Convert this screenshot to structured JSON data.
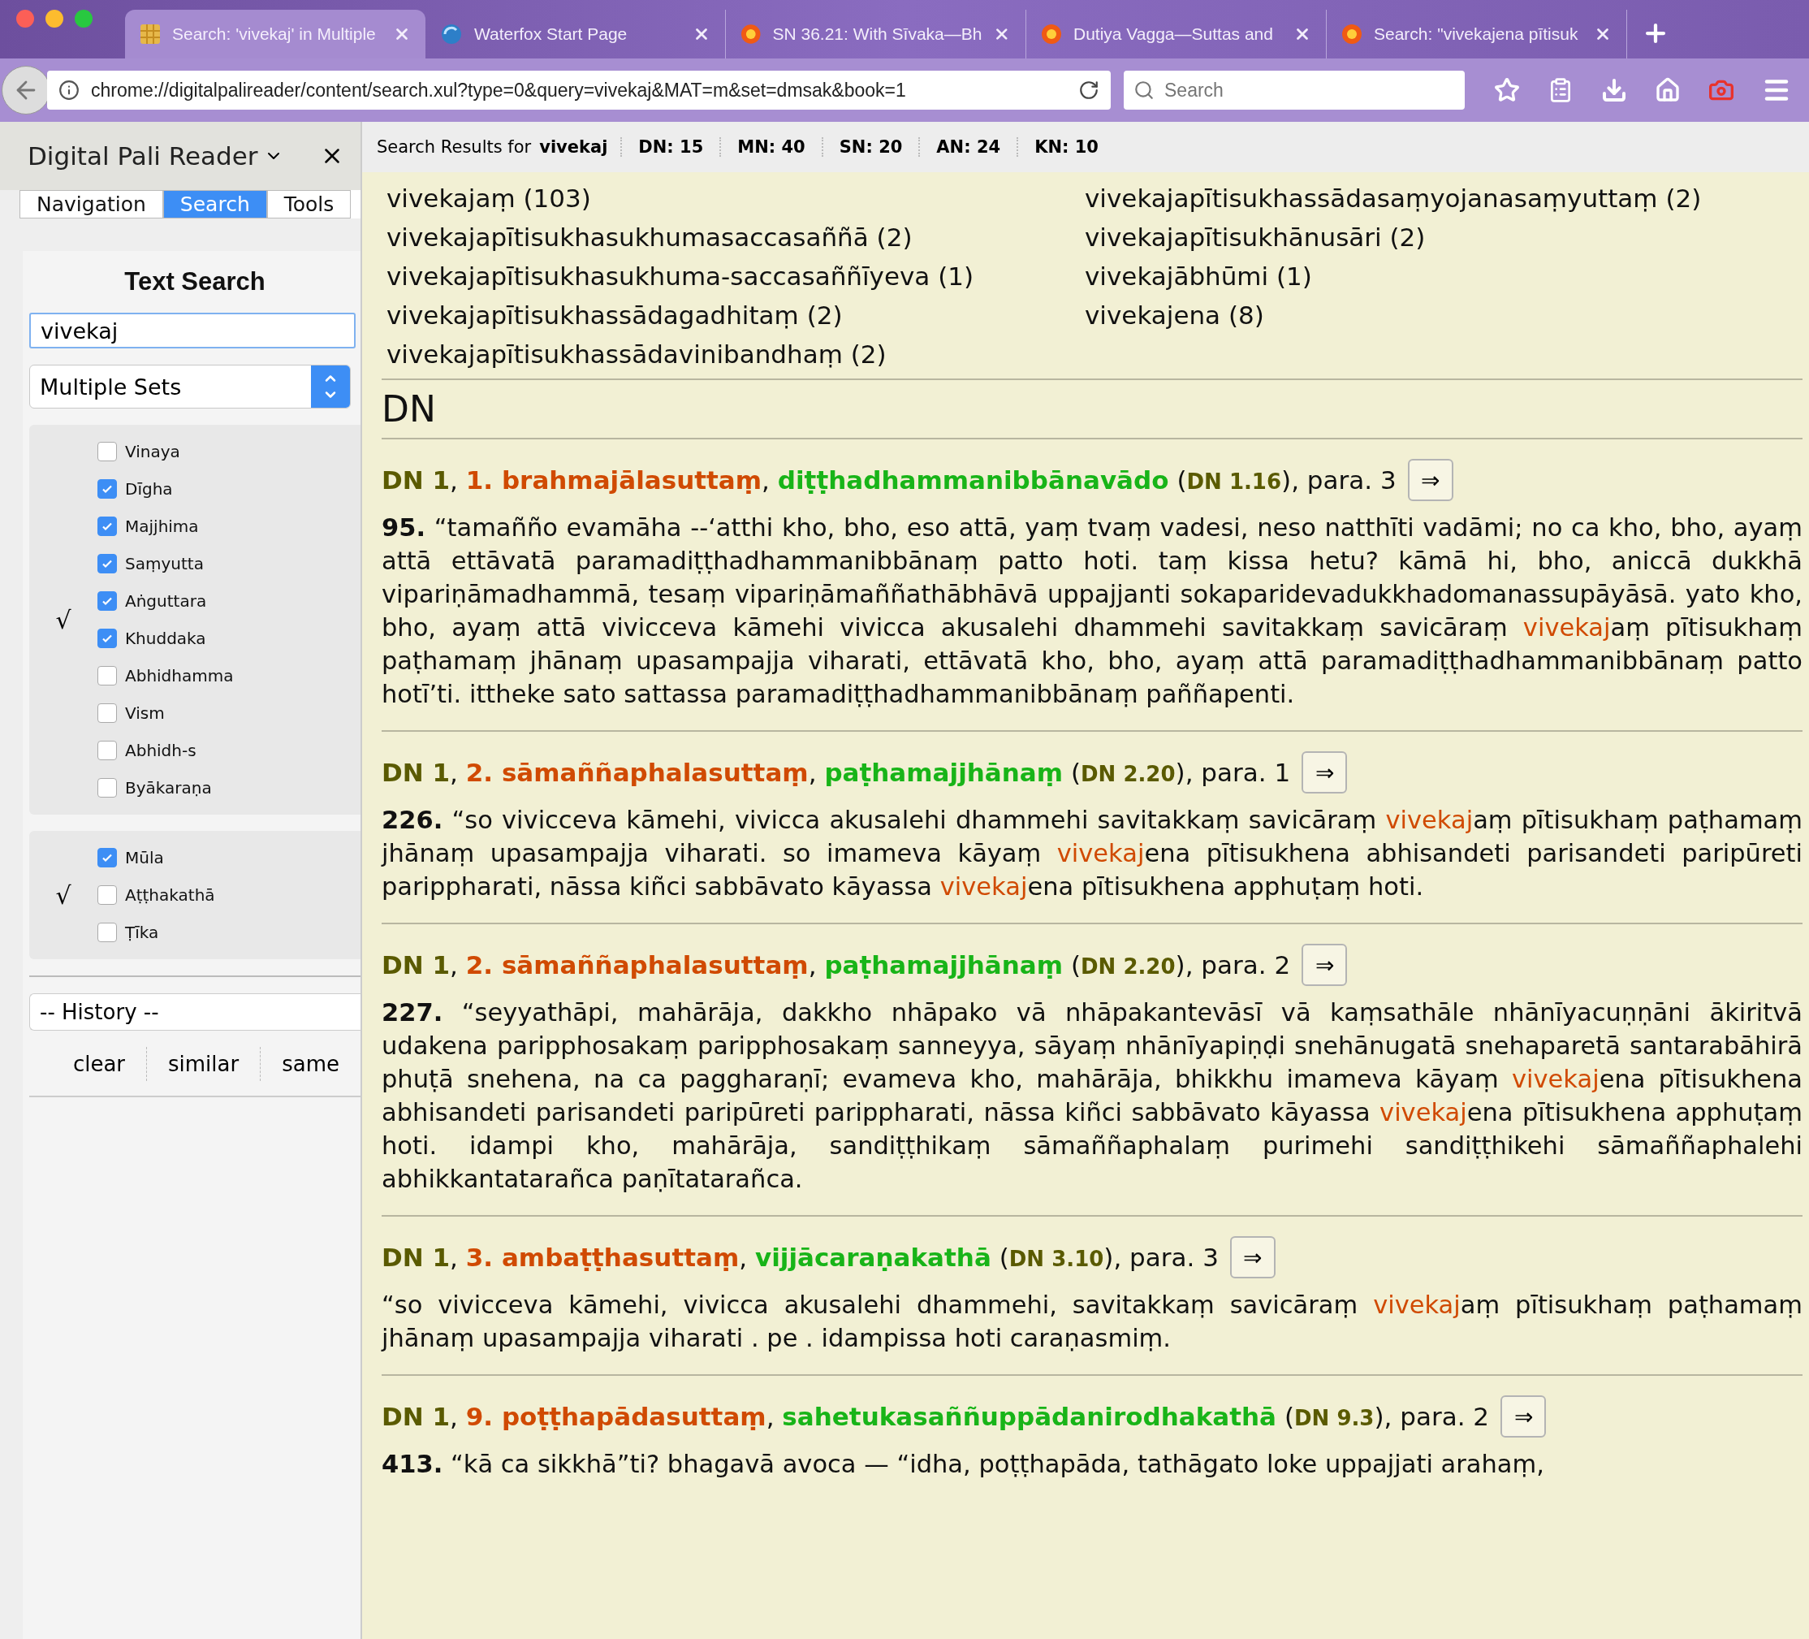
{
  "browser": {
    "tabs": [
      {
        "title": "Search: 'vivekaj' in Multiple",
        "kind": "tile",
        "selected": true
      },
      {
        "title": "Waterfox Start Page",
        "kind": "globe",
        "selected": false
      },
      {
        "title": "SN 36.21: With Sīvaka—Bh",
        "kind": "sun",
        "selected": false
      },
      {
        "title": "Dutiya Vagga—Suttas and",
        "kind": "sun",
        "selected": false
      },
      {
        "title": "Search: \"vivekajena pītisuk",
        "kind": "sun",
        "selected": false
      }
    ],
    "url": "chrome://digitalpalireader/content/search.xul?type=0&query=vivekaj&MAT=m&set=dmsak&book=1",
    "search": {
      "placeholder": "Search"
    }
  },
  "sidebar": {
    "title": "Digital Pali Reader",
    "tabs": [
      {
        "label": "Navigation",
        "selected": false
      },
      {
        "label": "Search",
        "selected": true
      },
      {
        "label": "Tools",
        "selected": false
      }
    ],
    "heading": "Text Search",
    "query": "vivekaj",
    "set": "Multiple Sets",
    "groups": [
      {
        "mark": "√",
        "items": [
          {
            "label": "Vinaya",
            "checked": false
          },
          {
            "label": "Dīgha",
            "checked": true
          },
          {
            "label": "Majjhima",
            "checked": true
          },
          {
            "label": "Saṃyutta",
            "checked": true
          },
          {
            "label": "Aṅguttara",
            "checked": true
          },
          {
            "label": "Khuddaka",
            "checked": true
          },
          {
            "label": "Abhidhamma",
            "checked": false
          },
          {
            "label": "Vism",
            "checked": false
          },
          {
            "label": "Abhidh-s",
            "checked": false
          },
          {
            "label": "Byākaraṇa",
            "checked": false
          }
        ]
      },
      {
        "mark": "√",
        "items": [
          {
            "label": "Mūla",
            "checked": true
          },
          {
            "label": "Aṭṭhakathā",
            "checked": false
          },
          {
            "label": "Ṭīka",
            "checked": false
          }
        ]
      }
    ],
    "history": "-- History --",
    "actions": [
      "clear",
      "similar",
      "same"
    ]
  },
  "results": {
    "label": "Search Results for",
    "query": "vivekaj",
    "counts": [
      "DN: 15",
      "MN: 40",
      "SN: 20",
      "AN: 24",
      "KN: 10"
    ],
    "words": [
      "vivekajaṃ (103)",
      "vivekajapītisukhasukhumasaccasaññā (2)",
      "vivekajapītisukhasukhuma-saccasaññīyeva (1)",
      "vivekajapītisukhassādagadhitaṃ (2)",
      "vivekajapītisukhassādavinibandhaṃ (2)",
      "vivekajapītisukhassādasaṃyojanasaṃyuttaṃ (2)",
      "vivekajapītisukhānusāri (2)",
      "vivekajābhūmi (1)",
      "vivekajena (8)"
    ],
    "sections": [
      {
        "title": "DN",
        "hits": [
          {
            "heading": [
              {
                "kind": "book",
                "text": "DN 1"
              },
              {
                "kind": "plain",
                "text": ", "
              },
              {
                "kind": "sutta",
                "text": "1. brahmajālasuttaṃ"
              },
              {
                "kind": "plain",
                "text": ", "
              },
              {
                "kind": "section",
                "text": "diṭṭhadhammanibbānavādo"
              },
              {
                "kind": "plain",
                "text": " ("
              },
              {
                "kind": "ref",
                "text": "DN 1.16"
              },
              {
                "kind": "plain",
                "text": "), para. 3"
              }
            ],
            "go": "⇒",
            "paragraph": [
              {
                "text": "**95.** “tamañño evamāha --‘atthi kho, bho, eso attā, yaṃ tvaṃ vadesi, neso natthīti vadāmi; no ca kho, bho, ayaṃ attā ettāvatā paramadiṭṭhadhammanibbānaṃ patto hoti. taṃ kissa hetu? kāmā hi, bho, aniccā dukkhā vipariṇāmadhammā, tesaṃ vipariṇāmaññathābhāvā uppajjanti sokaparidevadukkhadomanassupāyāsā. yato kho, bho, ayaṃ attā vivicceva kāmehi vivicca akusalehi dhammehi savitakkaṃ savicāraṃ ",
                "hit": false
              },
              {
                "text": "vivekaj",
                "hit": true
              },
              {
                "text": "aṃ pītisukhaṃ paṭhamaṃ jhānaṃ upasampajja viharati, ettāvatā kho, bho, ayaṃ attā paramadiṭṭhadhammanibbānaṃ patto hotī’ti. ittheke sato sattassa paramadiṭṭhadhammanibbānaṃ paññapenti.",
                "hit": false
              }
            ]
          },
          {
            "heading": [
              {
                "kind": "book",
                "text": "DN 1"
              },
              {
                "kind": "plain",
                "text": ", "
              },
              {
                "kind": "sutta",
                "text": "2. sāmaññaphalasuttaṃ"
              },
              {
                "kind": "plain",
                "text": ", "
              },
              {
                "kind": "section",
                "text": "paṭhamajjhānaṃ"
              },
              {
                "kind": "plain",
                "text": " ("
              },
              {
                "kind": "ref",
                "text": "DN 2.20"
              },
              {
                "kind": "plain",
                "text": "), para. 1"
              }
            ],
            "go": "⇒",
            "paragraph": [
              {
                "text": "**226.** “so vivicceva kāmehi, vivicca akusalehi dhammehi savitakkaṃ savicāraṃ ",
                "hit": false
              },
              {
                "text": "vivekaj",
                "hit": true
              },
              {
                "text": "aṃ pītisukhaṃ paṭhamaṃ jhānaṃ upasampajja viharati. so imameva kāyaṃ ",
                "hit": false
              },
              {
                "text": "vivekaj",
                "hit": true
              },
              {
                "text": "ena pītisukhena abhisandeti parisandeti paripūreti parippharati, nāssa kiñci sabbāvato kāyassa ",
                "hit": false
              },
              {
                "text": "vivekaj",
                "hit": true
              },
              {
                "text": "ena pītisukhena apphuṭaṃ hoti.",
                "hit": false
              }
            ]
          },
          {
            "heading": [
              {
                "kind": "book",
                "text": "DN 1"
              },
              {
                "kind": "plain",
                "text": ", "
              },
              {
                "kind": "sutta",
                "text": "2. sāmaññaphalasuttaṃ"
              },
              {
                "kind": "plain",
                "text": ", "
              },
              {
                "kind": "section",
                "text": "paṭhamajjhānaṃ"
              },
              {
                "kind": "plain",
                "text": " ("
              },
              {
                "kind": "ref",
                "text": "DN 2.20"
              },
              {
                "kind": "plain",
                "text": "), para. 2"
              }
            ],
            "go": "⇒",
            "paragraph": [
              {
                "text": "**227.** “seyyathāpi, mahārāja, dakkho nhāpako vā nhāpakantevāsī vā kaṃsathāle nhānīyacuṇṇāni ākiritvā udakena paripphosakaṃ paripphosakaṃ sanneyya, sāyaṃ nhānīyapiṇḍi snehānugatā snehaparetā santarabāhirā phuṭā snehena, na ca paggharaṇī; evameva kho, mahārāja, bhikkhu imameva kāyaṃ ",
                "hit": false
              },
              {
                "text": "vivekaj",
                "hit": true
              },
              {
                "text": "ena pītisukhena abhisandeti parisandeti paripūreti parippharati, nāssa kiñci sabbāvato kāyassa ",
                "hit": false
              },
              {
                "text": "vivekaj",
                "hit": true
              },
              {
                "text": "ena pītisukhena apphuṭaṃ hoti. idampi kho, mahārāja, sandiṭṭhikaṃ sāmaññaphalaṃ purimehi sandiṭṭhikehi sāmaññaphalehi abhikkantatarañca paṇītatarañca.",
                "hit": false
              }
            ]
          },
          {
            "heading": [
              {
                "kind": "book",
                "text": "DN 1"
              },
              {
                "kind": "plain",
                "text": ", "
              },
              {
                "kind": "sutta",
                "text": "3. ambaṭṭhasuttaṃ"
              },
              {
                "kind": "plain",
                "text": ", "
              },
              {
                "kind": "section",
                "text": "vijjācaraṇakathā"
              },
              {
                "kind": "plain",
                "text": " ("
              },
              {
                "kind": "ref",
                "text": "DN 3.10"
              },
              {
                "kind": "plain",
                "text": "), para. 3"
              }
            ],
            "go": "⇒",
            "paragraph": [
              {
                "text": "“so vivicceva kāmehi, vivicca akusalehi dhammehi, savitakkaṃ savicāraṃ ",
                "hit": false
              },
              {
                "text": "vivekaj",
                "hit": true
              },
              {
                "text": "aṃ pītisukhaṃ paṭhamaṃ jhānaṃ upasampajja viharati . pe . idampissa hoti caraṇasmiṃ.",
                "hit": false
              }
            ]
          },
          {
            "heading": [
              {
                "kind": "book",
                "text": "DN 1"
              },
              {
                "kind": "plain",
                "text": ", "
              },
              {
                "kind": "sutta",
                "text": "9. poṭṭhapādasuttaṃ"
              },
              {
                "kind": "plain",
                "text": ", "
              },
              {
                "kind": "section",
                "text": "sahetukasaññuppādanirodhakathā"
              },
              {
                "kind": "plain",
                "text": " ("
              },
              {
                "kind": "ref",
                "text": "DN 9.3"
              },
              {
                "kind": "plain",
                "text": "), para. 2"
              }
            ],
            "go": "⇒",
            "paragraph": [
              {
                "text": "**413.** “kā ca sikkhā”ti? bhagavā avoca — “idha, poṭṭhapāda, tathāgato loke uppajjati arahaṃ,",
                "hit": false
              }
            ]
          }
        ]
      }
    ]
  }
}
